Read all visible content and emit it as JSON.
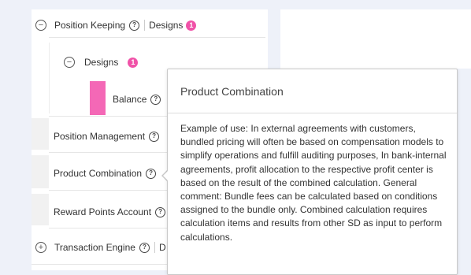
{
  "tree": {
    "position_keeping": {
      "label": "Position Keeping",
      "tag": "Designs",
      "badge": "1"
    },
    "designs": {
      "label": "Designs",
      "badge": "1"
    },
    "balance": {
      "label": "Balance"
    },
    "position_management": {
      "label": "Position Management"
    },
    "product_combination": {
      "label": "Product Combination"
    },
    "reward_points_account": {
      "label": "Reward Points Account"
    },
    "transaction_engine": {
      "label": "Transaction Engine",
      "tag_partial": "D"
    }
  },
  "tooltip": {
    "title": "Product Combination",
    "body": "Example of use: In external agreements with customers, bundled pricing will often be based on compensation models to simplify operations and fulfill auditing purposes, In bank-internal agreements, profit allocation to the respective profit center is based on the result of the combined calculation. General comment: Bundle fees can be calculated based on conditions assigned to the bundle only. Combined calculation requires calculation items and results from other SD as input to perform calculations."
  },
  "icons": {
    "help": "?",
    "collapse": "−",
    "expand": "+"
  },
  "colors": {
    "badge": "#f052a8",
    "balance_bar": "#f468b6",
    "background": "#eef1f9"
  }
}
